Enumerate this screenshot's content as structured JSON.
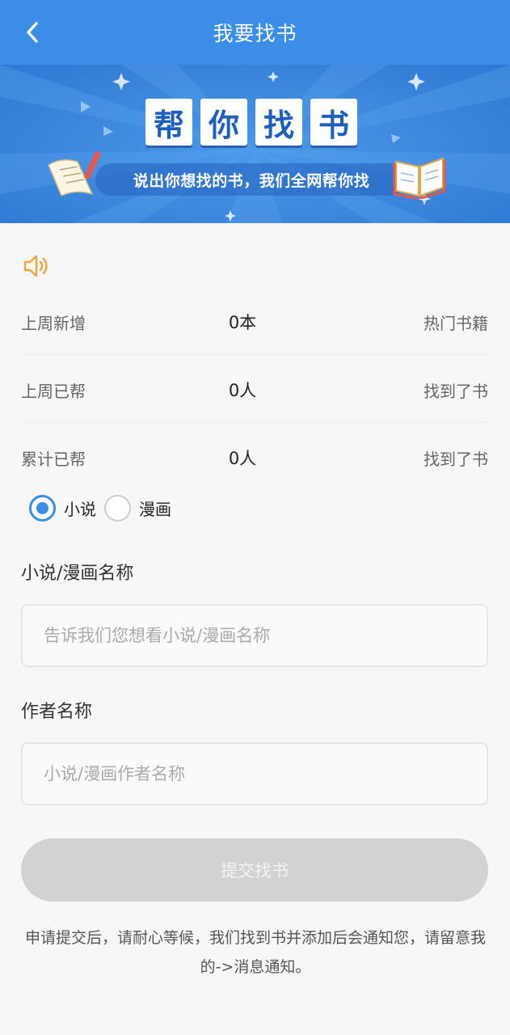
{
  "header": {
    "title": "我要找书"
  },
  "banner": {
    "tiles": [
      "帮",
      "你",
      "找",
      "书"
    ],
    "slogan": "说出你想找的书，我们全网帮你找"
  },
  "stats": [
    {
      "label": "上周新增",
      "value": "0本",
      "link": "热门书籍"
    },
    {
      "label": "上周已帮",
      "value": "0人",
      "link": "找到了书"
    },
    {
      "label": "累计已帮",
      "value": "0人",
      "link": "找到了书"
    }
  ],
  "type_options": [
    {
      "label": "小说",
      "selected": true
    },
    {
      "label": "漫画",
      "selected": false
    }
  ],
  "form": {
    "name_label": "小说/漫画名称",
    "name_placeholder": "告诉我们您想看小说/漫画名称",
    "author_label": "作者名称",
    "author_placeholder": "小说/漫画作者名称",
    "submit_label": "提交找书"
  },
  "notice": "申请提交后，请耐心等候，我们找到书并添加后会通知您，请留意我的->消息通知。",
  "colors": {
    "primary": "#3b8de8",
    "accent_icon": "#f2a33a",
    "disabled_button": "#d2d2d2"
  },
  "icons": {
    "back": "chevron-left-icon",
    "speaker": "speaker-icon"
  }
}
